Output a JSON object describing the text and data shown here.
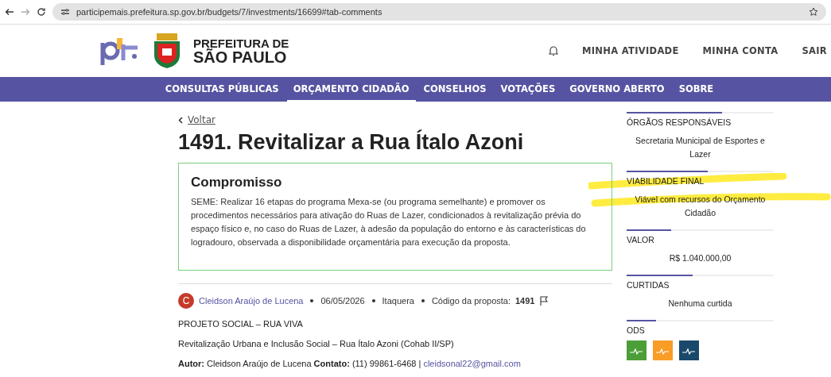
{
  "browser": {
    "url": "participemais.prefeitura.sp.gov.br/budgets/7/investments/16699#tab-comments"
  },
  "header": {
    "logo_text": [
      "PREFEITURA DE",
      "SÃO PAULO"
    ],
    "links": [
      "MINHA ATIVIDADE",
      "MINHA CONTA",
      "SAIR"
    ]
  },
  "nav": [
    {
      "label": "CONSULTAS PÚBLICAS",
      "selected": false
    },
    {
      "label": "ORÇAMENTO CIDADÃO",
      "selected": true
    },
    {
      "label": "CONSELHOS",
      "selected": false
    },
    {
      "label": "VOTAÇÕES",
      "selected": false
    },
    {
      "label": "GOVERNO ABERTO",
      "selected": false
    },
    {
      "label": "SOBRE",
      "selected": false
    }
  ],
  "back": "Voltar",
  "title": "1491. Revitalizar a Rua Ítalo Azoni",
  "commitment": {
    "title": "Compromisso",
    "text": "SEME: Realizar 16 etapas do programa Mexa-se (ou programa semelhante) e promover os procedimentos necessários para ativação do Ruas de Lazer, condicionados à revitalização prévia do espaço físico e, no caso do Ruas de Lazer, à adesão da população do entorno e às características do logradouro, observada a disponibilidade orçamentária para execução da proposta."
  },
  "meta": {
    "avatar": "C",
    "author": "Cleidson Araújo de Lucena",
    "date": "06/05/2026",
    "district": "Itaquera",
    "code_label": "Código da proposta:",
    "code": "1491"
  },
  "body": [
    "PROJETO SOCIAL – RUA VIVA",
    "Revitalização Urbana e Inclusão Social – Rua Ítalo Azoni (Cohab II/SP)",
    "**Autor:** Cleidson Araújo de Lucena **Contato:** (11) 99861-6468 |"
  ],
  "email": "cleidsonal22@gmail.com",
  "sidebar": [
    {
      "heading": "ÓRGÃOS RESPONSÁVEIS",
      "value": "Secretaria Municipal de Esportes e Lazer"
    },
    {
      "heading": "VIABILIDADE FINAL",
      "value": "Viável com recursos do Orçamento Cidadão"
    },
    {
      "heading": "VALOR",
      "value": "R$ 1.040.000,00"
    },
    {
      "heading": "CURTIDAS",
      "value": "Nenhuma curtida"
    }
  ],
  "ods": {
    "heading": "ODS",
    "items": [
      {
        "color": "#4c9f38"
      },
      {
        "color": "#f99d26"
      },
      {
        "color": "#19486a"
      }
    ]
  }
}
